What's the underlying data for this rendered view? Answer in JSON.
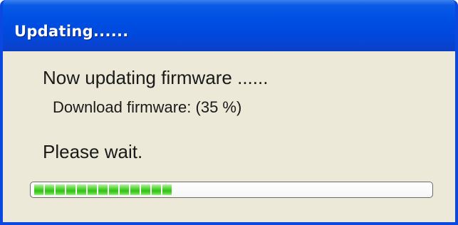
{
  "window": {
    "title": "Updating......"
  },
  "message": {
    "main": "Now updating firmware ......",
    "download": "Download firmware:  (35 %)",
    "wait": "Please wait."
  },
  "progress": {
    "percent": 35
  },
  "colors": {
    "titlebar": "#0050e4",
    "client_background": "#ece9d8",
    "progress_fill": "#2fc114"
  }
}
